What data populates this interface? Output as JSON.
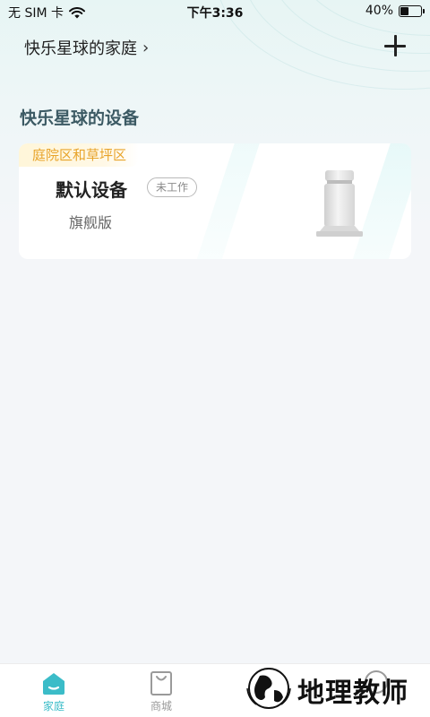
{
  "status_bar": {
    "carrier": "无 SIM 卡",
    "time": "下午3:36",
    "battery": "40%",
    "battery_level": 0.4
  },
  "header": {
    "home_name": "快乐星球的家庭",
    "chevron": "›"
  },
  "section": {
    "title": "快乐星球的设备"
  },
  "device_card": {
    "zone": "庭院区和草坪区",
    "name": "默认设备",
    "status": "未工作",
    "model": "旗舰版"
  },
  "tabbar": {
    "tabs": [
      {
        "label": "家庭",
        "icon": "home-icon",
        "active": true
      },
      {
        "label": "商城",
        "icon": "shop-bag-icon",
        "active": false
      },
      {
        "label": "",
        "icon": "device-icon",
        "active": false
      },
      {
        "label": "",
        "icon": "profile-icon",
        "active": false
      }
    ]
  },
  "watermark": {
    "text": "地理教师"
  },
  "colors": {
    "accent": "#3bbcc8",
    "zone_text": "#e8a42b",
    "section_title": "#3c5a64"
  }
}
